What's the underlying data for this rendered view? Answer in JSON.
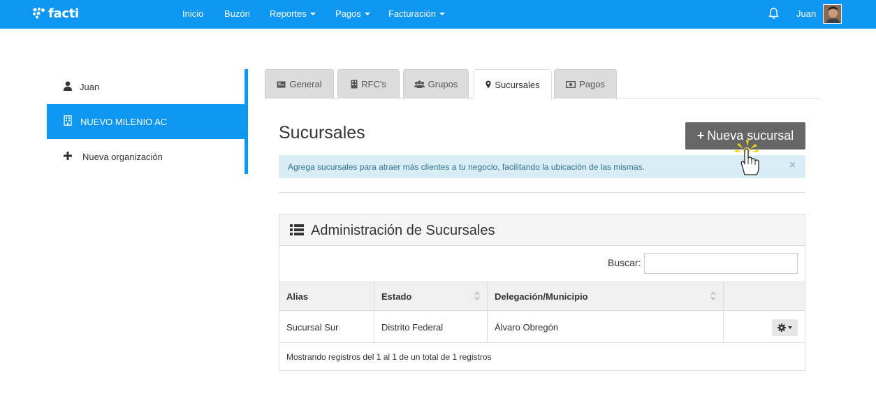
{
  "brand": {
    "logo_text": "facti"
  },
  "nav": {
    "items": [
      {
        "label": "Inicio"
      },
      {
        "label": "Buzón"
      },
      {
        "label": "Reportes"
      },
      {
        "label": "Pagos"
      },
      {
        "label": "Facturación"
      }
    ],
    "user": "Juan"
  },
  "sidebar": {
    "items": [
      {
        "label": "Juan"
      },
      {
        "label": "NUEVO MILENIO AC"
      },
      {
        "label": "Nueva organización"
      }
    ]
  },
  "tabs": [
    {
      "label": "General"
    },
    {
      "label": "RFC's"
    },
    {
      "label": "Grupos"
    },
    {
      "label": "Sucursales"
    },
    {
      "label": "Pagos"
    }
  ],
  "main": {
    "title": "Sucursales",
    "new_button": "Nueva sucursal",
    "new_button_plus": "+",
    "alert": "Agrega sucursales para atraer más clientes a tu negocio, facilitando la ubicación de las mismas.",
    "alert_close": "×"
  },
  "panel": {
    "title": "Administración de Sucursales",
    "search_label": "Buscar:",
    "columns": [
      "Alias",
      "Estado",
      "Delegación/Municipio"
    ],
    "rows": [
      {
        "alias": "Sucursal Sur",
        "estado": "Distrito Federal",
        "delegacion": "Álvaro Obregón"
      }
    ],
    "info": "Mostrando registros del 1 al 1 de un total de 1 registros"
  },
  "colors": {
    "primary": "#0d96f2",
    "button": "#666666",
    "alert_bg": "#d9edf7",
    "alert_text": "#31708f"
  }
}
